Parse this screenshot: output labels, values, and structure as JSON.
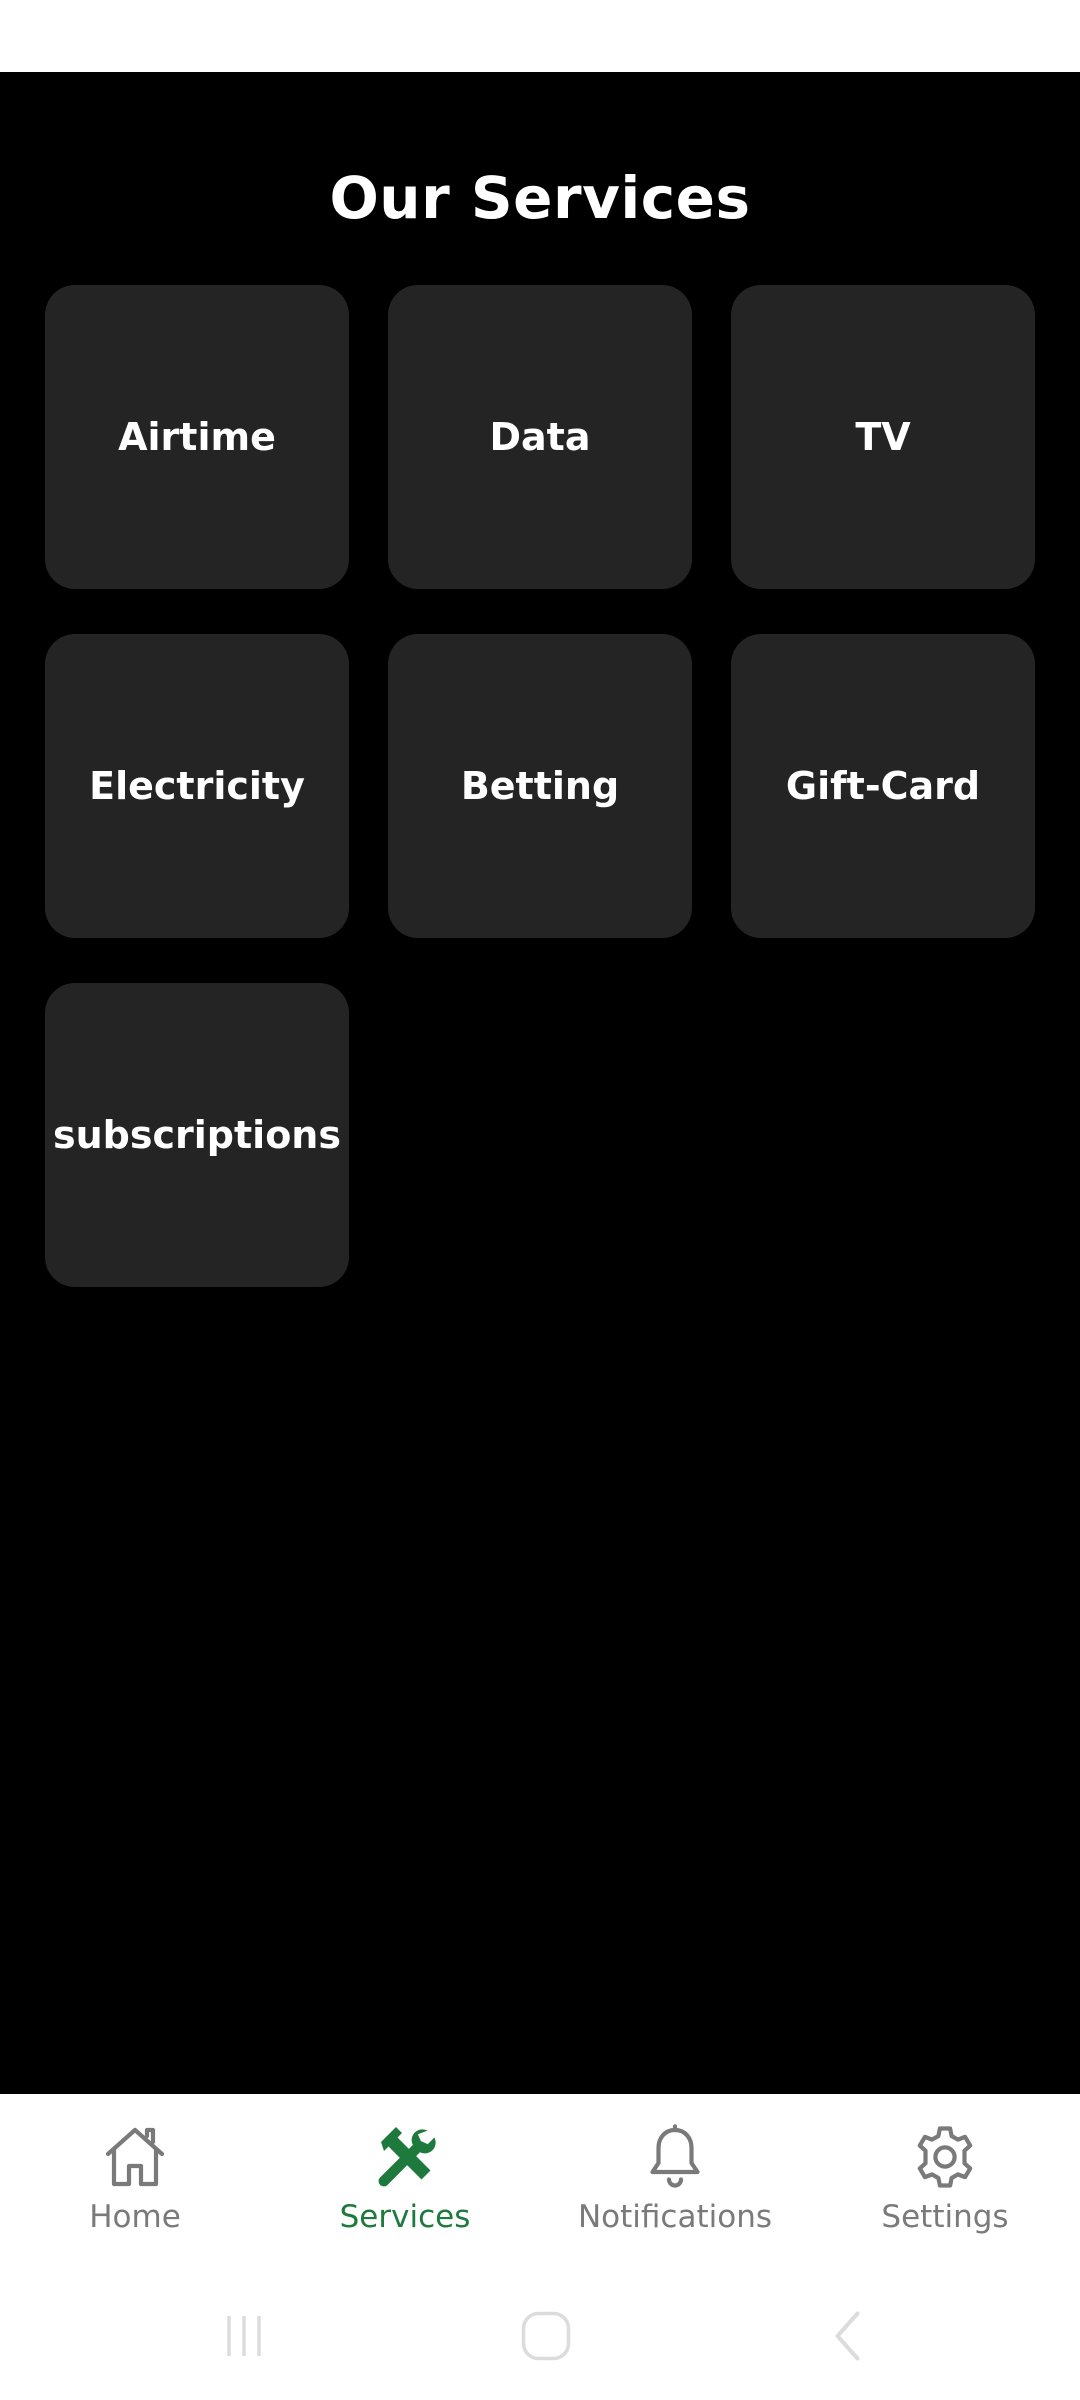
{
  "page": {
    "title": "Our Services"
  },
  "services": [
    {
      "label": "Airtime"
    },
    {
      "label": "Data"
    },
    {
      "label": "TV"
    },
    {
      "label": "Electricity"
    },
    {
      "label": "Betting"
    },
    {
      "label": "Gift-Card"
    },
    {
      "label": "subscriptions"
    }
  ],
  "bottom_nav": {
    "items": [
      {
        "label": "Home",
        "icon": "home-icon",
        "active": false
      },
      {
        "label": "Services",
        "icon": "tools-icon",
        "active": true
      },
      {
        "label": "Notifications",
        "icon": "bell-icon",
        "active": false
      },
      {
        "label": "Settings",
        "icon": "gear-icon",
        "active": false
      }
    ]
  },
  "colors": {
    "background": "#000000",
    "tile": "#242424",
    "accent": "#1e7a3c",
    "inactive": "#7a7a7a"
  }
}
